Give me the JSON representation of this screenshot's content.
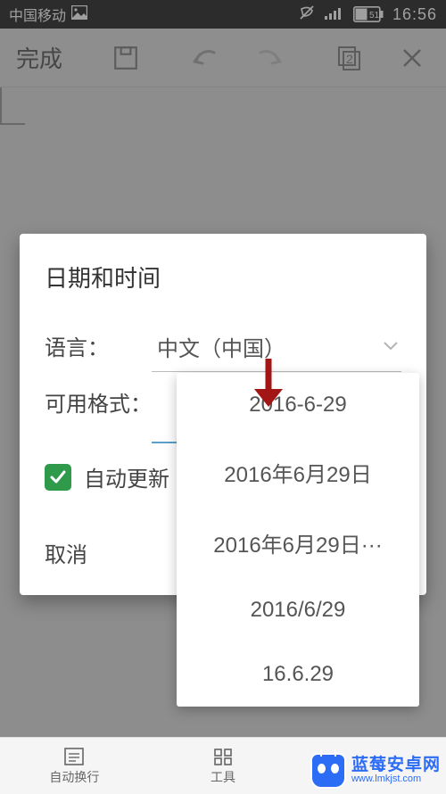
{
  "statusbar": {
    "carrier": "中国移动",
    "battery": "51",
    "time": "16:56"
  },
  "appbar": {
    "done": "完成",
    "icons": {
      "save": "save-icon",
      "undo": "undo-icon",
      "redo": "redo-icon",
      "pages": "pages-icon",
      "close": "close-icon"
    },
    "page_badge": "2"
  },
  "dialog": {
    "title": "日期和时间",
    "language_label": "语言：",
    "language_value": "中文（中国）",
    "format_label": "可用格式：",
    "auto_update_label": "自动更新",
    "cancel_label": "取消"
  },
  "format_dropdown": {
    "options": [
      "2016-6-29",
      "2016年6月29日",
      "2016年6月29日···",
      "2016/6/29",
      "16.6.29"
    ]
  },
  "bottombar": {
    "item0": "自动换行",
    "item1": "工具",
    "item2": ""
  },
  "watermark": {
    "brand": "蓝莓安卓网",
    "url": "www.lmkjst.com"
  }
}
